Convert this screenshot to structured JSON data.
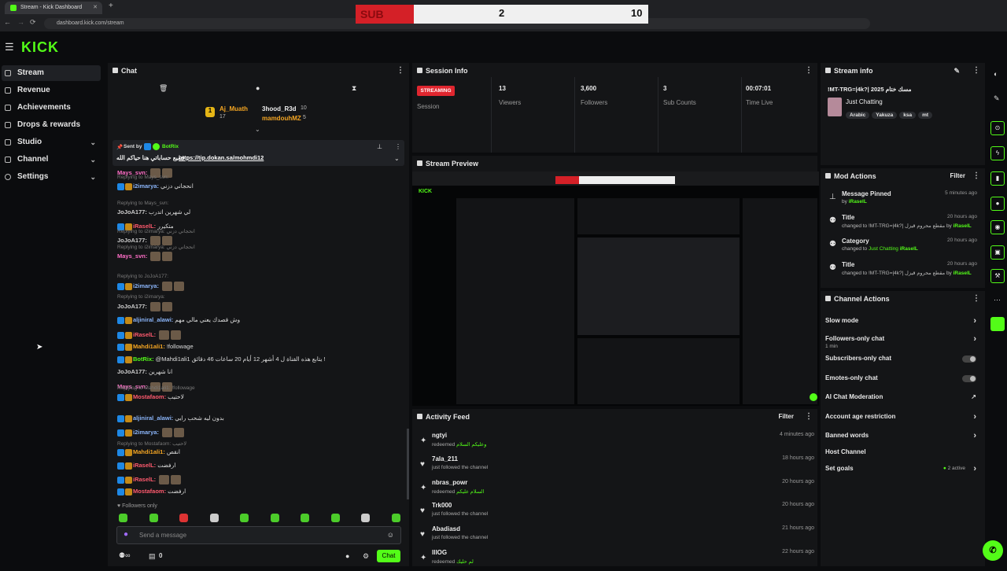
{
  "browser": {
    "tab_title": "Stream - Kick Dashboard",
    "url": "dashboard.kick.com/stream"
  },
  "scorebar": {
    "label": "SUB",
    "value_a": "2",
    "value_b": "10"
  },
  "logo": "KICK",
  "sidebar": {
    "items": [
      {
        "label": "Stream",
        "active": true,
        "chevron": false
      },
      {
        "label": "Revenue",
        "active": false,
        "chevron": false
      },
      {
        "label": "Achievements",
        "active": false,
        "chevron": false
      },
      {
        "label": "Drops & rewards",
        "active": false,
        "chevron": false
      },
      {
        "label": "Studio",
        "active": false,
        "chevron": true
      },
      {
        "label": "Channel",
        "active": false,
        "chevron": true
      },
      {
        "label": "Settings",
        "active": false,
        "chevron": true
      }
    ]
  },
  "chat": {
    "title": "Chat",
    "top_gifters": [
      {
        "name": "Aj_Muath",
        "count": "17"
      },
      {
        "name": "3hood_R3d",
        "count": "10"
      },
      {
        "name": "mamdouhMZ",
        "count": "5"
      }
    ],
    "pinned": {
      "sent_by_label": "Sent by",
      "sender": "BotRix",
      "text": "جميع حساباتي هنا حياكم الله :",
      "link": "https://tip.dokan.sa/mohmdi12"
    },
    "messages": [
      {
        "user": "Mays_svn:",
        "color": "#ff6ec7",
        "text": "",
        "reply": ""
      },
      {
        "user": "i2imarya:",
        "color": "#8ab4f8",
        "text": "انحجاني دزني",
        "reply": "Replying to Mays_svn:"
      },
      {
        "user": "JoJoA177:",
        "color": "#cccccc",
        "text": "لي شهرين اتدرب",
        "reply": "Replying to Mays_svn:"
      },
      {
        "user": "iRaselL:",
        "color": "#ff5a6e",
        "text": "متكيرر",
        "reply": ""
      },
      {
        "user": "JoJoA177:",
        "color": "#cccccc",
        "text": "",
        "reply": "Replying to i2imarya: انحجاني دزني"
      },
      {
        "user": "Mays_svn:",
        "color": "#ff6ec7",
        "text": "",
        "reply": "Replying to i2imarya: انحجاني دزني"
      },
      {
        "user": "i2imarya:",
        "color": "#8ab4f8",
        "text": "",
        "reply": "Replying to JoJoA177:"
      },
      {
        "user": "JoJoA177:",
        "color": "#cccccc",
        "text": "",
        "reply": "Replying to i2imarya:"
      },
      {
        "user": "aljiniral_alawi:",
        "color": "#8ab4f8",
        "text": "وش قصدك يعني مالي مهم",
        "reply": ""
      },
      {
        "user": "iRaselL:",
        "color": "#ff5a6e",
        "text": "",
        "reply": ""
      },
      {
        "user": "Mahdi1ali1:",
        "color": "#f5a623",
        "text": "!followage",
        "reply": ""
      },
      {
        "user": "BotRix:",
        "color": "#53fc18",
        "text": "@Mahdi1ali1 يتابع هذه القناة ل 4 أشهر 12 أيام 20 ساعات 46 دقائق !",
        "reply": ""
      },
      {
        "user": "JoJoA177:",
        "color": "#cccccc",
        "text": "انا شهرين",
        "reply": ""
      },
      {
        "user": "Mays_svn:",
        "color": "#ff6ec7",
        "text": "",
        "reply": ""
      },
      {
        "user": "Mostafaom:",
        "color": "#ff5a6e",
        "text": "لاحتيب",
        "reply": "Replying to Mahdi1ali1: !followage"
      },
      {
        "user": "aljiniral_alawi:",
        "color": "#8ab4f8",
        "text": "بدون ليه شحب رايي",
        "reply": ""
      },
      {
        "user": "i2imarya:",
        "color": "#8ab4f8",
        "text": "",
        "reply": ""
      },
      {
        "user": "Mahdi1ali1:",
        "color": "#f5a623",
        "text": "انقص",
        "reply": "Replying to Mostafaom: لاحتيب"
      },
      {
        "user": "iRaselL:",
        "color": "#ff5a6e",
        "text": "ارفضت",
        "reply": ""
      },
      {
        "user": "iRaselL:",
        "color": "#ff5a6e",
        "text": "",
        "reply": ""
      },
      {
        "user": "Mostafaom:",
        "color": "#ff5a6e",
        "text": "ارفضت",
        "reply": ""
      }
    ],
    "followers_only": "Followers only",
    "input_placeholder": "Send a message",
    "viewer_count": "0",
    "send_label": "Chat"
  },
  "session": {
    "title": "Session Info",
    "status_badge": "STREAMING",
    "session_label": "Session",
    "stats": [
      {
        "value": "13",
        "label": "Viewers"
      },
      {
        "value": "3,600",
        "label": "Followers"
      },
      {
        "value": "3",
        "label": "Sub Counts"
      },
      {
        "value": "00:07:01",
        "label": "Time Live"
      }
    ]
  },
  "preview": {
    "title": "Stream Preview"
  },
  "activity": {
    "title": "Activity Feed",
    "filter": "Filter",
    "items": [
      {
        "name": "ngtyi",
        "desc": "redeemed",
        "extra": "وعليكم السلام",
        "time": "4 minutes ago",
        "icon": "✦"
      },
      {
        "name": "7ala_211",
        "desc": "just followed the channel",
        "extra": "",
        "time": "18 hours ago",
        "icon": "♥"
      },
      {
        "name": "nbras_powr",
        "desc": "redeemed",
        "extra": "السلام عليكم",
        "time": "20 hours ago",
        "icon": "✦"
      },
      {
        "name": "Trk000",
        "desc": "just followed the channel",
        "extra": "",
        "time": "20 hours ago",
        "icon": "♥"
      },
      {
        "name": "Abadiasd",
        "desc": "just followed the channel",
        "extra": "",
        "time": "21 hours ago",
        "icon": "♥"
      },
      {
        "name": "lllOG",
        "desc": "redeemed",
        "extra": "لم حليك",
        "time": "22 hours ago",
        "icon": "✦"
      }
    ]
  },
  "stream_info": {
    "title": "Stream info",
    "stream_title": "!MT-TRG=|4k?| 2025 مسك ختام",
    "category": "Just Chatting",
    "tags": [
      "Arabic",
      "Yakuza",
      "ksa",
      "mt"
    ]
  },
  "mod_actions": {
    "title": "Mod Actions",
    "filter": "Filter",
    "items": [
      {
        "name": "Message Pinned",
        "desc": "by",
        "who": "iRaselL",
        "changed": "",
        "time": "5 minutes ago"
      },
      {
        "name": "Title",
        "desc": "changed to !MT-TRG=|4k?| مقطع محروم قيزل by",
        "who": "iRaselL",
        "changed": "",
        "time": "20 hours ago"
      },
      {
        "name": "Category",
        "desc": "changed to",
        "changed": "Just Chatting",
        "who": "iRaselL",
        "time": "20 hours ago"
      },
      {
        "name": "Title",
        "desc": "changed to !MT-TRG=|4k?| مقطع محروم قيزل by",
        "who": "iRaselL",
        "changed": "",
        "time": "20 hours ago"
      }
    ]
  },
  "channel_actions": {
    "title": "Channel Actions",
    "items": [
      {
        "label": "Slow mode",
        "sub": "",
        "control": "arrow"
      },
      {
        "label": "Followers-only chat",
        "sub": "1 min",
        "control": "arrow"
      },
      {
        "label": "Subscribers-only chat",
        "sub": "",
        "control": "toggle"
      },
      {
        "label": "Emotes-only chat",
        "sub": "",
        "control": "toggle"
      },
      {
        "label": "AI Chat Moderation",
        "sub": "",
        "control": "external"
      },
      {
        "label": "Account age restriction",
        "sub": "",
        "control": "arrow"
      },
      {
        "label": "Banned words",
        "sub": "",
        "control": "arrow"
      },
      {
        "label": "Host Channel",
        "sub": "",
        "control": "none"
      },
      {
        "label": "Set goals",
        "sub": "",
        "control": "arrow",
        "status": "2 active"
      }
    ]
  },
  "colors": {
    "accent": "#53fc18",
    "live_red": "#e0262f",
    "panel": "#141517"
  }
}
